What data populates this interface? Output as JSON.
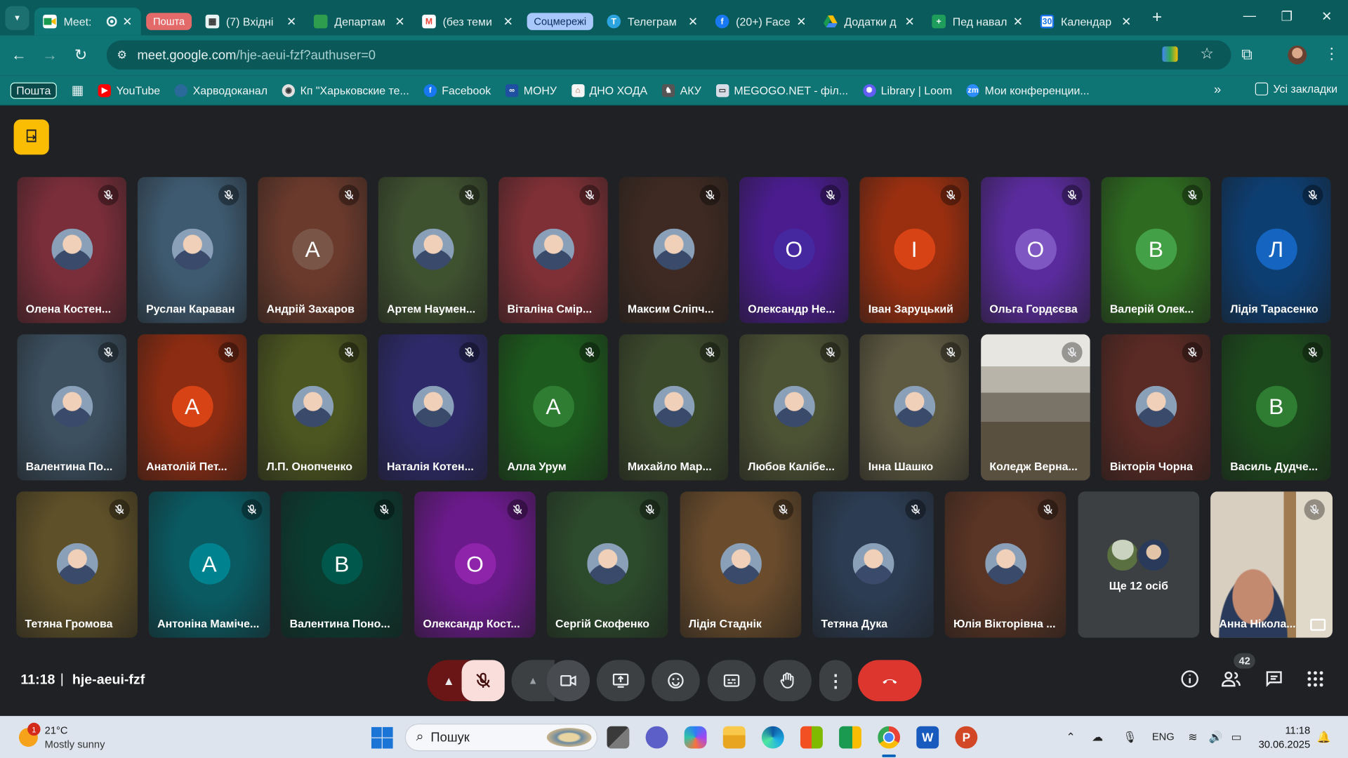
{
  "browser": {
    "tabs": [
      {
        "title": "Meet:",
        "fav": "#1a9a50",
        "active": true
      },
      {
        "title": "(7) Вхідні",
        "fav": "#333"
      },
      {
        "title": "Департам",
        "fav": "#2e9d4e"
      },
      {
        "title": "(без теми",
        "fav": "#ea4335"
      },
      {
        "title": "Телеграм",
        "fav": "#2aa3df"
      },
      {
        "title": "(20+) Face",
        "fav": "#1877f2"
      },
      {
        "title": "Додатки д",
        "fav": "#fbbc04"
      },
      {
        "title": "Пед навал",
        "fav": "#1e9e5a"
      },
      {
        "title": "Календар",
        "fav": "#1a73e8"
      }
    ],
    "group_label_mail": "Пошта",
    "group_label_social": "Соцмережі",
    "url_host": "meet.google.com",
    "url_path": "/hje-aeui-fzf?authuser=0",
    "bookmarks": [
      "Пошта",
      "YouTube",
      "Харводоканал",
      "Кп \"Харьковские те...",
      "Facebook",
      "МОНУ",
      "ДНО ХОДА",
      "АКУ",
      "MEGOGO.NET - філ...",
      "Library | Loom",
      "Мои конференции..."
    ],
    "all_bookmarks": "Усі закладки"
  },
  "meet": {
    "time": "11:18",
    "code": "hje-aeui-fzf",
    "participant_count": "42",
    "more_people": "Ще 12 осіб",
    "participants": [
      {
        "name": "Олена Костен...",
        "bg": "#7a2e3a",
        "initial": "",
        "photo": true
      },
      {
        "name": "Руслан Караван",
        "bg": "#3e5a70",
        "initial": "",
        "photo": true
      },
      {
        "name": "Андрій Захаров",
        "bg": "#6a3a2c",
        "initial": "А",
        "avbg": "#795548"
      },
      {
        "name": "Артем Наумен...",
        "bg": "#3f5230",
        "initial": "",
        "photo": true
      },
      {
        "name": "Віталіна Смір...",
        "bg": "#7e3036",
        "initial": "",
        "photo": true
      },
      {
        "name": "Максим Сліпч...",
        "bg": "#3e2a22",
        "initial": "",
        "photo": true
      },
      {
        "name": "Олександр Не...",
        "bg": "#4a1c8e",
        "initial": "О",
        "avbg": "#4527a0"
      },
      {
        "name": "Іван Заруцький",
        "bg": "#9a2f10",
        "initial": "І",
        "avbg": "#d84315"
      },
      {
        "name": "Ольга Гордєєва",
        "bg": "#5a2b9c",
        "initial": "О",
        "avbg": "#7e57c2"
      },
      {
        "name": "Валерій Олек...",
        "bg": "#2e6b20",
        "initial": "В",
        "avbg": "#43a047"
      },
      {
        "name": "Лідія Тарасенко",
        "bg": "#0d3e72",
        "initial": "Л",
        "avbg": "#1565c0"
      },
      {
        "name": "Валентина По...",
        "bg": "#3c5060",
        "initial": "",
        "photo": true
      },
      {
        "name": "Анатолій Пет...",
        "bg": "#8c2c12",
        "initial": "А",
        "avbg": "#d84315"
      },
      {
        "name": "Л.П. Онопченко",
        "bg": "#4c5620",
        "initial": "",
        "photo": true
      },
      {
        "name": "Наталія Котен...",
        "bg": "#2e2a6a",
        "initial": "",
        "photo": true
      },
      {
        "name": "Алла Урум",
        "bg": "#1d5a1d",
        "initial": "А",
        "avbg": "#2e7d32"
      },
      {
        "name": "Михайло Мар...",
        "bg": "#3c4a2c",
        "initial": "",
        "photo": true
      },
      {
        "name": "Любов Калібе...",
        "bg": "#4c5234",
        "initial": "",
        "photo": true
      },
      {
        "name": "Інна Шашко",
        "bg": "#5e5a42",
        "initial": "",
        "photo": true
      },
      {
        "name": "Коледж Верна...",
        "bg": "#8a8478",
        "initial": "",
        "video": true
      },
      {
        "name": "Вікторія Чорна",
        "bg": "#5a2a24",
        "initial": "",
        "photo": true
      },
      {
        "name": "Василь Дудче...",
        "bg": "#1c4a1c",
        "initial": "В",
        "avbg": "#2e7d32"
      },
      {
        "name": "Тетяна Громова",
        "bg": "#5e5028",
        "initial": "",
        "photo": true
      },
      {
        "name": "Антоніна Маміче...",
        "bg": "#0a5a62",
        "initial": "А",
        "avbg": "#00838f"
      },
      {
        "name": "Валентина Поно...",
        "bg": "#0a3c30",
        "initial": "В",
        "avbg": "#00574b"
      },
      {
        "name": "Олександр Кост...",
        "bg": "#6a1a8a",
        "initial": "О",
        "avbg": "#8e24aa"
      },
      {
        "name": "Сергій Скофенко",
        "bg": "#2c4a2c",
        "initial": "",
        "photo": true
      },
      {
        "name": "Лідія Стаднік",
        "bg": "#6a4c2c",
        "initial": "",
        "photo": true
      },
      {
        "name": "Тетяна Дука",
        "bg": "#2c3c52",
        "initial": "",
        "photo": true
      },
      {
        "name": "Юлія Вікторівна ...",
        "bg": "#5a3424",
        "initial": "",
        "photo": true
      },
      {
        "name": "Анна Нікола...",
        "bg": "#b8a890",
        "initial": "",
        "video": true
      }
    ]
  },
  "taskbar": {
    "weather_temp": "21°C",
    "weather_cond": "Mostly sunny",
    "weather_badge": "1",
    "search_placeholder": "Пошук",
    "lang": "ENG",
    "time": "11:18",
    "date": "30.06.2025"
  }
}
